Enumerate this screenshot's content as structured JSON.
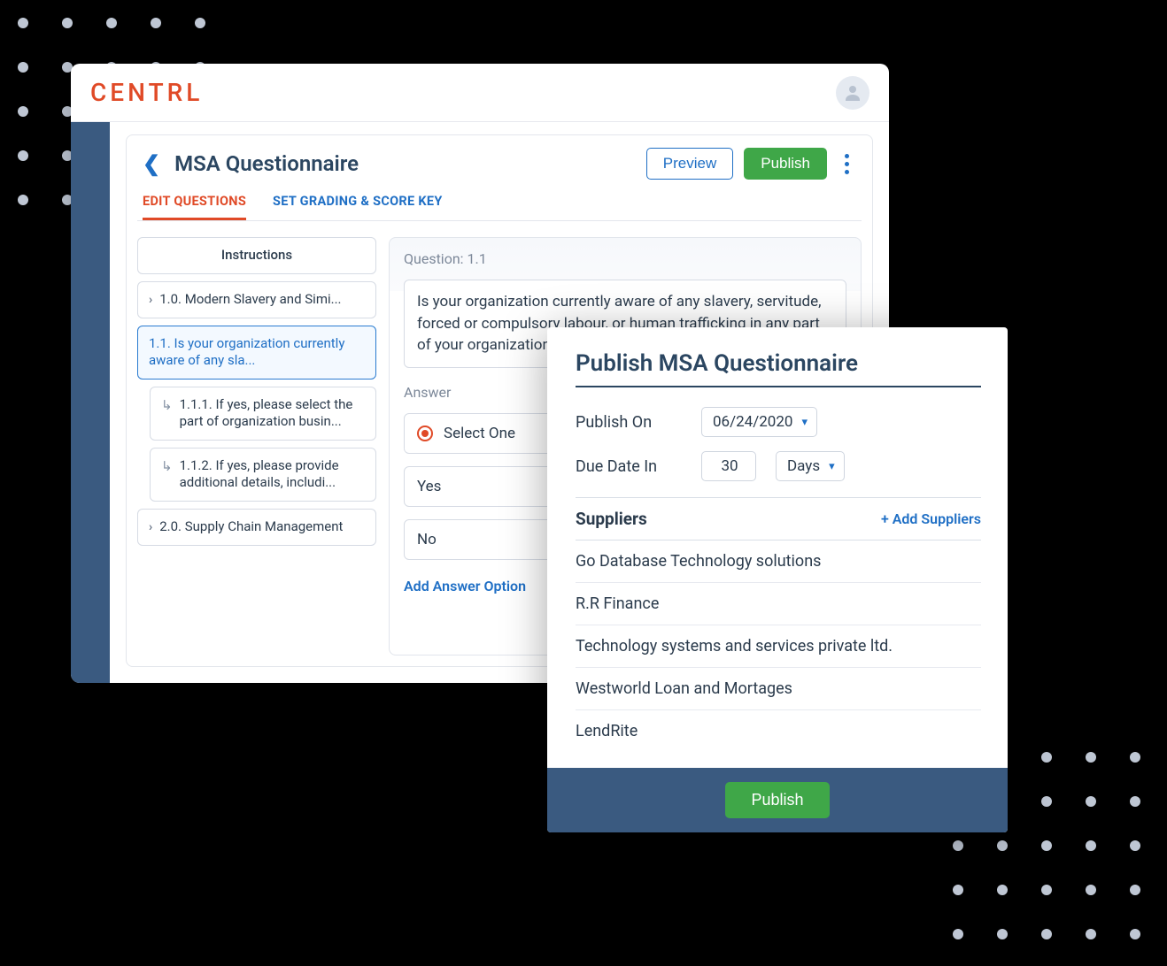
{
  "logo": "CENTRL",
  "header": {
    "back_icon": "‹",
    "title": "MSA Questionnaire",
    "preview_label": "Preview",
    "publish_label": "Publish"
  },
  "tabs": {
    "edit": "EDIT QUESTIONS",
    "grading": "SET GRADING & SCORE KEY"
  },
  "tree": {
    "instructions": "Instructions",
    "items": [
      {
        "label": "1.0. Modern Slavery and Simi..."
      },
      {
        "label": "1.1. Is your organization currently aware of any sla..."
      },
      {
        "label": "1.1.1. If yes, please select the part of organization busin..."
      },
      {
        "label": "1.1.2. If yes, please provide additional details, includi..."
      },
      {
        "label": "2.0. Supply Chain Management"
      }
    ]
  },
  "question": {
    "num_label": "Question: 1.1",
    "text": "Is your organization currently aware of any slavery, servitude, forced or compulsory labour, or human trafficking in any part of your organization's business (including all sites)?",
    "answer_label": "Answer",
    "options": {
      "select_one": "Select One",
      "yes": "Yes",
      "no": "No"
    },
    "add_option": "Add Answer Option"
  },
  "publish_modal": {
    "title": "Publish MSA Questionnaire",
    "publish_on_label": "Publish On",
    "publish_on_value": "06/24/2020",
    "due_in_label": "Due Date In",
    "due_in_value": "30",
    "due_in_unit": "Days",
    "suppliers_label": "Suppliers",
    "add_suppliers": "+ Add Suppliers",
    "suppliers": [
      "Go Database Technology solutions",
      "R.R Finance",
      "Technology systems and services private ltd.",
      "Westworld Loan and Mortages",
      "LendRite"
    ],
    "publish_button": "Publish"
  }
}
